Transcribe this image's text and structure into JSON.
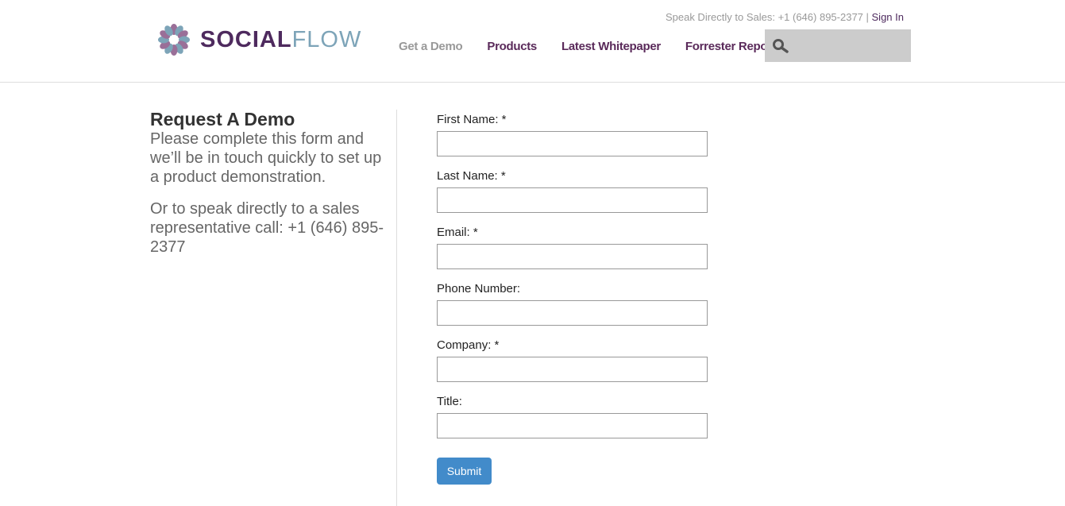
{
  "header": {
    "logo_text": "SOCIALFLOW",
    "sales_text": "Speak Directly to Sales: +1 (646) 895-2377",
    "separator": " | ",
    "sign_in": "Sign In",
    "nav": [
      {
        "label": "Get a Demo"
      },
      {
        "label": "Products"
      },
      {
        "label": "Latest Whitepaper"
      },
      {
        "label": "Forrester Report"
      }
    ],
    "search_icon": "search-icon"
  },
  "intro": {
    "title": "Request A Demo",
    "p1": "Please complete this form and we’ll be in touch quickly to set up a product demonstration.",
    "p2": "Or to speak directly to a sales representative call: +1 (646) 895-2377"
  },
  "form": {
    "fields": [
      {
        "label": "First Name: *"
      },
      {
        "label": "Last Name: *"
      },
      {
        "label": "Email: *"
      },
      {
        "label": "Phone Number:"
      },
      {
        "label": "Company: *"
      },
      {
        "label": "Title:"
      }
    ],
    "submit": "Submit"
  },
  "colors": {
    "brand_purple": "#4e2a5e",
    "brand_blue": "#7da4b8",
    "button": "#428bca"
  }
}
